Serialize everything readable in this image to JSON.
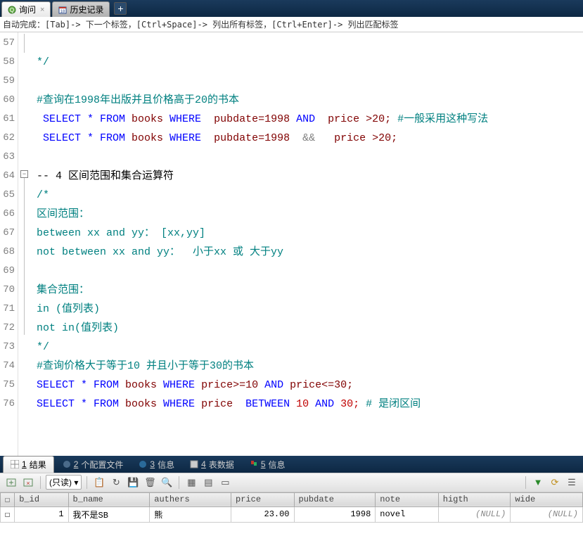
{
  "tabs": {
    "query": "询问",
    "history": "历史记录"
  },
  "hint": "自动完成：[Tab]-> 下一个标签，[Ctrl+Space]-> 列出所有标签，[Ctrl+Enter]-> 列出匹配标签",
  "gutter": [
    "57",
    "58",
    "59",
    "60",
    "61",
    "62",
    "63",
    "64",
    "65",
    "66",
    "67",
    "68",
    "69",
    "70",
    "71",
    "72",
    "73",
    "74",
    "75",
    "76"
  ],
  "code": {
    "l57": "*/",
    "l59": "#查询在1998年出版并且价格高于20的书本",
    "l60_sel": " SELECT * FROM ",
    "l60_books": "books",
    "l60_where": " WHERE  ",
    "l60_pub": "pubdate=1998",
    "l60_and": " AND  ",
    "l60_price": "price >20; ",
    "l60_cmt": "#一般采用这种写法",
    "l61_sel": " SELECT * FROM ",
    "l61_books": "books",
    "l61_where": " WHERE  ",
    "l61_pub": "pubdate=1998 ",
    "l61_and": " &&   ",
    "l61_price": "price >20;",
    "l63": "-- 4 区间范围和集合运算符",
    "l64": "/*",
    "l65": "区间范围：",
    "l66": "between xx and yy： [xx,yy]",
    "l67": "not between xx and yy：  小于xx 或 大于yy",
    "l69": "集合范围：",
    "l70": "in (值列表)",
    "l71": "not in(值列表)",
    "l72": "*/",
    "l73": "#查询价格大于等于10 并且小于等于30的书本",
    "l74_sel": "SELECT * FROM ",
    "l74_books": "books",
    "l74_where": " WHERE ",
    "l74_p1": "price>=10",
    "l74_and": " AND ",
    "l74_p2": "price<=30;",
    "l75_sel": "SELECT * FROM ",
    "l75_books": "books",
    "l75_where": " WHERE ",
    "l75_price": "price",
    "l75_between": "  BETWEEN ",
    "l75_10": "10",
    "l75_and": " AND ",
    "l75_30": "30; ",
    "l75_cmt": "# 是闭区间"
  },
  "bottomTabs": {
    "result": {
      "num": "1",
      "label": "结果"
    },
    "profile": {
      "num": "2",
      "label": "个配置文件"
    },
    "info": {
      "num": "3",
      "label": "信息"
    },
    "tabledata": {
      "num": "4",
      "label": "表数据"
    },
    "info2": {
      "num": "5",
      "label": "信息"
    }
  },
  "toolbar": {
    "readonly": "(只读)"
  },
  "grid": {
    "headers": {
      "bid": "b_id",
      "bname": "b_name",
      "authers": "authers",
      "price": "price",
      "pubdate": "pubdate",
      "note": "note",
      "higth": "higth",
      "wide": "wide"
    },
    "row": {
      "bid": "1",
      "bname": "我不是SB",
      "authers": "熊",
      "price": "23.00",
      "pubdate": "1998",
      "note": "novel",
      "higth": "(NULL)",
      "wide": "(NULL)"
    }
  }
}
